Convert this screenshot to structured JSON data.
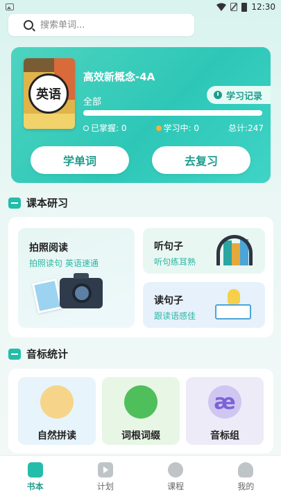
{
  "status_bar": {
    "time": "12:30"
  },
  "search": {
    "placeholder": "搜索单词..."
  },
  "book_card": {
    "cover_text": "英语",
    "title": "高效新概念-4A",
    "filter": "全部",
    "record_label": "学习记录",
    "progress_fraction": 0,
    "mastered_label": "已掌握: 0",
    "learning_label": "学习中: 0",
    "total_label": "总计:247",
    "learn_button": "学单词",
    "review_button": "去复习"
  },
  "textbook_section": {
    "title": "课本研习",
    "photo_read": {
      "title": "拍照阅读",
      "subtitle": "拍照读句 英语速通"
    },
    "listen": {
      "title": "听句子",
      "subtitle": "听句练耳熟"
    },
    "read": {
      "title": "读句子",
      "subtitle": "跟读语感佳"
    }
  },
  "phonetic_section": {
    "title": "音标统计",
    "items": [
      {
        "label": "自然拼读"
      },
      {
        "label": "词根词缀"
      },
      {
        "label": "音标组",
        "glyph": "æ"
      }
    ]
  },
  "tabbar": {
    "items": [
      {
        "label": "书本",
        "active": true
      },
      {
        "label": "计划"
      },
      {
        "label": "课程"
      },
      {
        "label": "我的"
      }
    ]
  },
  "colors": {
    "accent": "#23bda9",
    "accent_dark": "#1f9c8c"
  }
}
